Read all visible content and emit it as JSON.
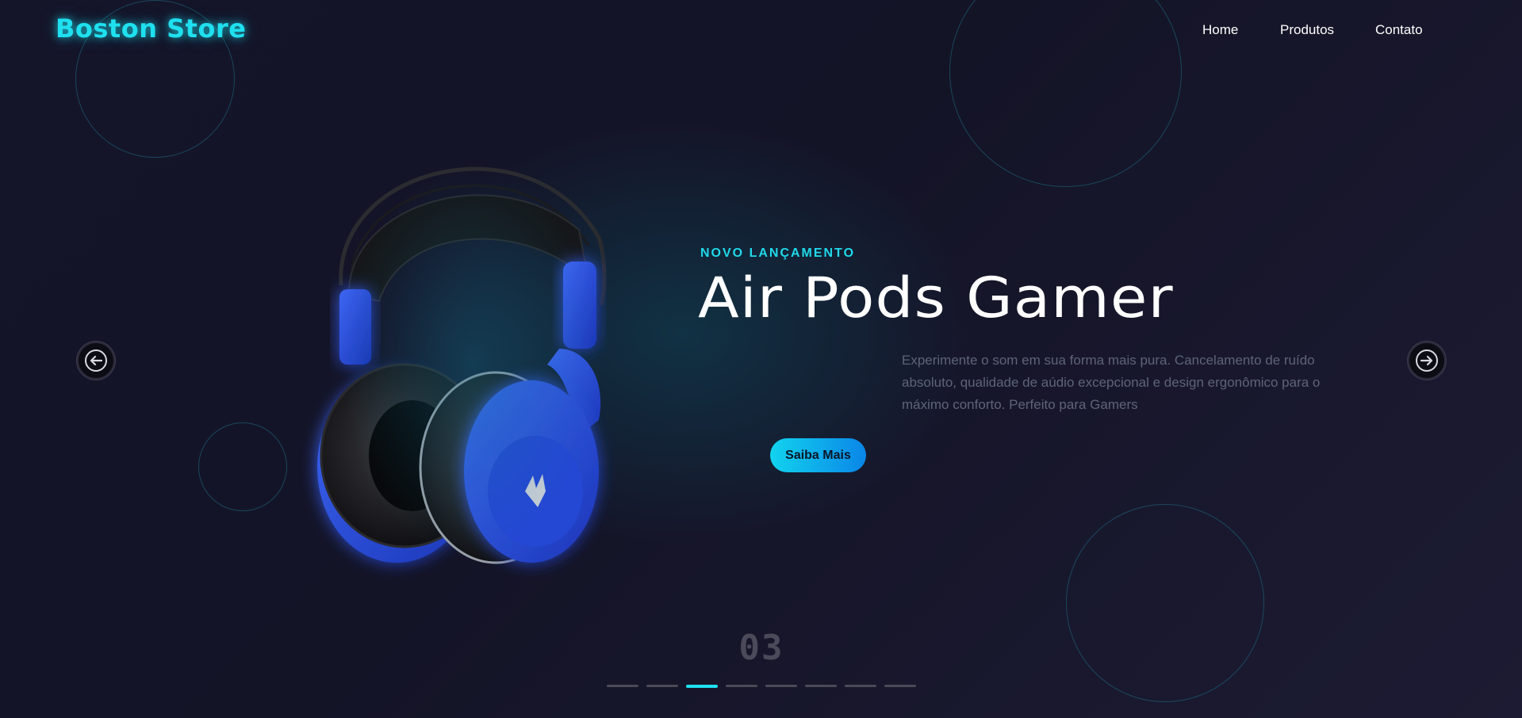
{
  "brand": {
    "logo": "Boston Store",
    "accent": "#1fe0ef"
  },
  "nav": {
    "items": [
      "Home",
      "Produtos",
      "Contato"
    ]
  },
  "hero": {
    "kicker": "NOVO LANÇAMENTO",
    "title": "Air Pods Gamer",
    "description": "Experimente o som em sua forma mais pura. Cancelamento de ruído absoluto, qualidade de aúdio excepcional e design ergonômico para o máximo conforto. Perfeito para Gamers",
    "cta_label": "Saiba Mais",
    "product_image": "blue-gaming-headphones"
  },
  "carousel": {
    "current_slide": "03",
    "total_dots": 8,
    "active_index": 2,
    "prev_icon": "arrow-left-icon",
    "next_icon": "arrow-right-icon"
  },
  "colors": {
    "background": "#171728",
    "accent": "#1fe0ef",
    "product_blue": "#2a4fd8",
    "muted_text": "#5e6478"
  }
}
